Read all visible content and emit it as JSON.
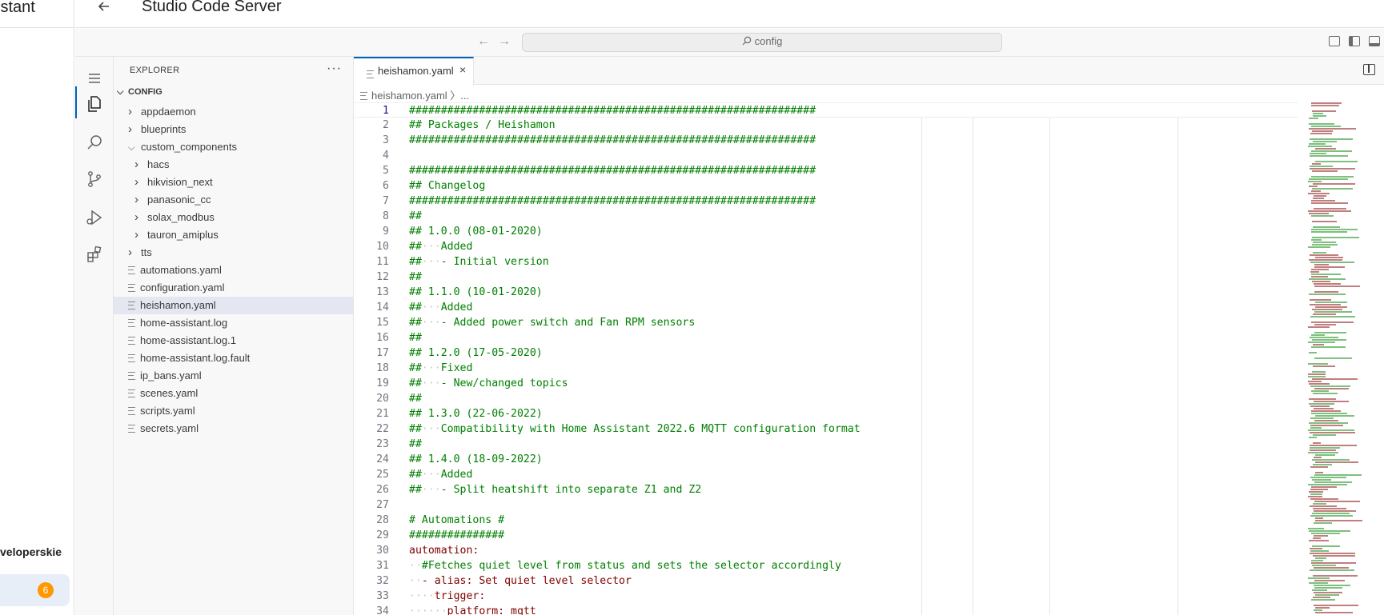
{
  "ha": {
    "title": "istant",
    "dev_label": "veloperskie",
    "notif_count": "6"
  },
  "header": {
    "title": "Studio Code Server"
  },
  "titlebar": {
    "search_text": "config"
  },
  "explorer": {
    "title": "EXPLORER",
    "more": "···",
    "root": "CONFIG",
    "items": [
      {
        "label": "appdaemon",
        "kind": "folder",
        "depth": 0,
        "open": false
      },
      {
        "label": "blueprints",
        "kind": "folder",
        "depth": 0,
        "open": false
      },
      {
        "label": "custom_components",
        "kind": "folder",
        "depth": 0,
        "open": true
      },
      {
        "label": "hacs",
        "kind": "folder",
        "depth": 1,
        "open": false
      },
      {
        "label": "hikvision_next",
        "kind": "folder",
        "depth": 1,
        "open": false
      },
      {
        "label": "panasonic_cc",
        "kind": "folder",
        "depth": 1,
        "open": false
      },
      {
        "label": "solax_modbus",
        "kind": "folder",
        "depth": 1,
        "open": false
      },
      {
        "label": "tauron_amiplus",
        "kind": "folder",
        "depth": 1,
        "open": false
      },
      {
        "label": "tts",
        "kind": "folder",
        "depth": 0,
        "open": false
      },
      {
        "label": "automations.yaml",
        "kind": "file",
        "depth": 0
      },
      {
        "label": "configuration.yaml",
        "kind": "file",
        "depth": 0
      },
      {
        "label": "heishamon.yaml",
        "kind": "file",
        "depth": 0,
        "selected": true
      },
      {
        "label": "home-assistant.log",
        "kind": "file",
        "depth": 0
      },
      {
        "label": "home-assistant.log.1",
        "kind": "file",
        "depth": 0
      },
      {
        "label": "home-assistant.log.fault",
        "kind": "file",
        "depth": 0
      },
      {
        "label": "ip_bans.yaml",
        "kind": "file",
        "depth": 0
      },
      {
        "label": "scenes.yaml",
        "kind": "file",
        "depth": 0
      },
      {
        "label": "scripts.yaml",
        "kind": "file",
        "depth": 0
      },
      {
        "label": "secrets.yaml",
        "kind": "file",
        "depth": 0
      }
    ]
  },
  "editor": {
    "tab_label": "heishamon.yaml",
    "tab_close": "×",
    "breadcrumb": "heishamon.yaml 〉...",
    "lines": [
      {
        "n": "1",
        "t": "################################################################",
        "c": "comment"
      },
      {
        "n": "2",
        "t": "## Packages / Heishamon",
        "c": "comment"
      },
      {
        "n": "3",
        "t": "################################################################",
        "c": "comment"
      },
      {
        "n": "4",
        "t": "",
        "c": "comment"
      },
      {
        "n": "5",
        "t": "################################################################",
        "c": "comment"
      },
      {
        "n": "6",
        "t": "## Changelog",
        "c": "comment"
      },
      {
        "n": "7",
        "t": "################################################################",
        "c": "comment"
      },
      {
        "n": "8",
        "t": "##",
        "c": "comment"
      },
      {
        "n": "9",
        "t": "## 1.0.0 (08-01-2020)",
        "c": "comment"
      },
      {
        "n": "10",
        "t": "##···Added",
        "c": "comment"
      },
      {
        "n": "11",
        "t": "##···- Initial version",
        "c": "comment"
      },
      {
        "n": "12",
        "t": "##",
        "c": "comment"
      },
      {
        "n": "13",
        "t": "## 1.1.0 (10-01-2020)",
        "c": "comment"
      },
      {
        "n": "14",
        "t": "##···Added",
        "c": "comment"
      },
      {
        "n": "15",
        "t": "##···- Added power switch and Fan RPM sensors",
        "c": "comment"
      },
      {
        "n": "16",
        "t": "##",
        "c": "comment"
      },
      {
        "n": "17",
        "t": "## 1.2.0 (17-05-2020)",
        "c": "comment"
      },
      {
        "n": "18",
        "t": "##···Fixed",
        "c": "comment"
      },
      {
        "n": "19",
        "t": "##···- New/changed topics",
        "c": "comment"
      },
      {
        "n": "20",
        "t": "##",
        "c": "comment"
      },
      {
        "n": "21",
        "t": "## 1.3.0 (22-06-2022)",
        "c": "comment"
      },
      {
        "n": "22",
        "t": "##···Compatibility with Home Assistant 2022.6 MQTT configuration format",
        "c": "comment"
      },
      {
        "n": "23",
        "t": "##",
        "c": "comment"
      },
      {
        "n": "24",
        "t": "## 1.4.0 (18-09-2022)",
        "c": "comment"
      },
      {
        "n": "25",
        "t": "##···Added",
        "c": "comment"
      },
      {
        "n": "26",
        "t": "##···- Split heatshift into separate Z1 and Z2",
        "c": "comment"
      },
      {
        "n": "27",
        "t": "",
        "c": "comment"
      },
      {
        "n": "28",
        "t": "# Automations #",
        "c": "comment"
      },
      {
        "n": "29",
        "t": "###############",
        "c": "comment"
      },
      {
        "n": "30",
        "t": "automation:",
        "c": "key"
      },
      {
        "n": "31",
        "t": "··#Fetches quiet level from status and sets the selector accordingly",
        "c": "comment"
      },
      {
        "n": "32",
        "t": "··- alias: Set quiet level selector",
        "c": "key"
      },
      {
        "n": "33",
        "t": "····trigger:",
        "c": "key"
      },
      {
        "n": "34",
        "t": "······platform: mqtt",
        "c": "key"
      }
    ]
  },
  "colors": {
    "accent": "#005fb8",
    "comment": "#008000",
    "key": "#800000",
    "badge": "#ff9800"
  }
}
